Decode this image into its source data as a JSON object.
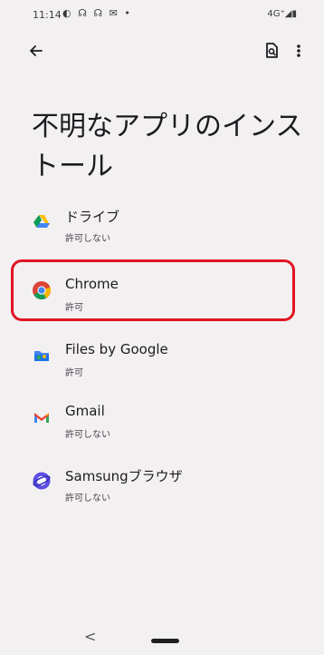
{
  "status_bar": {
    "time": "11:14",
    "notification_icons": "◐ ☊ ☊ ✉ •",
    "network": "4G⁺◢▮"
  },
  "toolbar": {
    "back_icon": "arrow-left",
    "search_icon": "search-in-page",
    "more_icon": "more-vertical"
  },
  "page": {
    "title": "不明なアプリのインストール"
  },
  "apps": [
    {
      "name": "ドライブ",
      "status": "許可しない",
      "icon": "google-drive-icon"
    },
    {
      "name": "Chrome",
      "status": "許可",
      "icon": "chrome-icon"
    },
    {
      "name": "Files by Google",
      "status": "許可",
      "icon": "files-by-google-icon"
    },
    {
      "name": "Gmail",
      "status": "許可しない",
      "icon": "gmail-icon"
    },
    {
      "name": "Samsungブラウザ",
      "status": "許可しない",
      "icon": "samsung-internet-icon"
    }
  ],
  "nav_bar": {
    "back_symbol": "<"
  },
  "colors": {
    "background": "#f3f0f2",
    "highlight": "#e01521",
    "text_primary": "#1c1b1f",
    "text_secondary": "#49454f"
  }
}
